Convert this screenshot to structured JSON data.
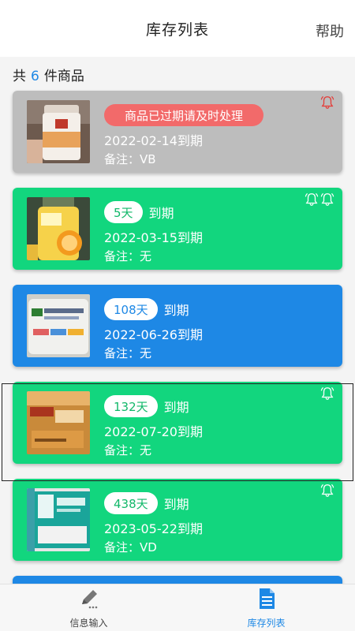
{
  "header": {
    "title": "库存列表",
    "help_label": "帮助"
  },
  "summary": {
    "prefix": "共",
    "count": "6",
    "suffix": "件商品"
  },
  "items": [
    {
      "status": "expired",
      "badge_text": "商品已过期请及时处理",
      "date": "2022-02-14到期",
      "note": "备注：VB",
      "bells": 1,
      "bell_color": "#e53935"
    },
    {
      "status": "green",
      "days": "5天",
      "due_suffix": "到期",
      "date": "2022-03-15到期",
      "note": "备注：无",
      "bells": 2
    },
    {
      "status": "blue",
      "days": "108天",
      "due_suffix": "到期",
      "date": "2022-06-26到期",
      "note": "备注：无",
      "bells": 0
    },
    {
      "status": "green",
      "days": "132天",
      "due_suffix": "到期",
      "date": "2022-07-20到期",
      "note": "备注：无",
      "bells": 1
    },
    {
      "status": "green",
      "days": "438天",
      "due_suffix": "到期",
      "date": "2023-05-22到期",
      "note": "备注：VD",
      "bells": 1
    }
  ],
  "tabs": [
    {
      "label": "信息输入",
      "icon": "pencil-icon",
      "active": false
    },
    {
      "label": "库存列表",
      "icon": "document-icon",
      "active": true
    }
  ],
  "colors": {
    "green": "#12d67e",
    "blue": "#1e88e5",
    "expired": "#bdbdbd",
    "alert": "#f26a6a",
    "accent": "#1e88e5"
  }
}
